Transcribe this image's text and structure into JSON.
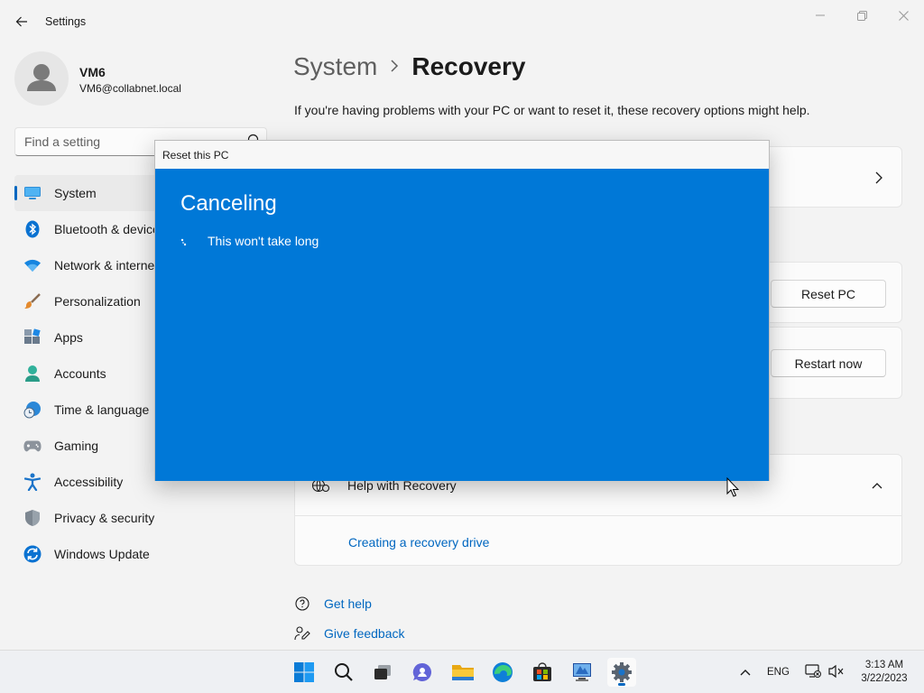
{
  "window": {
    "title": "Settings"
  },
  "profile": {
    "name": "VM6",
    "email": "VM6@collabnet.local"
  },
  "search": {
    "placeholder": "Find a setting"
  },
  "sidebar": {
    "items": [
      {
        "label": "System",
        "icon": "monitor-icon"
      },
      {
        "label": "Bluetooth & devices",
        "icon": "bluetooth-icon"
      },
      {
        "label": "Network & internet",
        "icon": "wifi-icon"
      },
      {
        "label": "Personalization",
        "icon": "brush-icon"
      },
      {
        "label": "Apps",
        "icon": "apps-icon"
      },
      {
        "label": "Accounts",
        "icon": "person-icon"
      },
      {
        "label": "Time & language",
        "icon": "globe-clock-icon"
      },
      {
        "label": "Gaming",
        "icon": "gamepad-icon"
      },
      {
        "label": "Accessibility",
        "icon": "accessibility-icon"
      },
      {
        "label": "Privacy & security",
        "icon": "shield-icon"
      },
      {
        "label": "Windows Update",
        "icon": "update-icon"
      }
    ]
  },
  "main": {
    "breadcrumb_parent": "System",
    "breadcrumb_current": "Recovery",
    "subtitle": "If you're having problems with your PC or want to reset it, these recovery options might help.",
    "reset_button": "Reset PC",
    "restart_button": "Restart now",
    "help_title": "Help with Recovery",
    "help_link": "Creating a recovery drive",
    "get_help": "Get help",
    "give_feedback": "Give feedback"
  },
  "dialog": {
    "title": "Reset this PC",
    "heading": "Canceling",
    "message": "This won't take long"
  },
  "taskbar": {
    "language": "ENG",
    "time": "3:13 AM",
    "date": "3/22/2023"
  },
  "colors": {
    "accent": "#0067c0",
    "dialog_bg": "#0078d7"
  }
}
